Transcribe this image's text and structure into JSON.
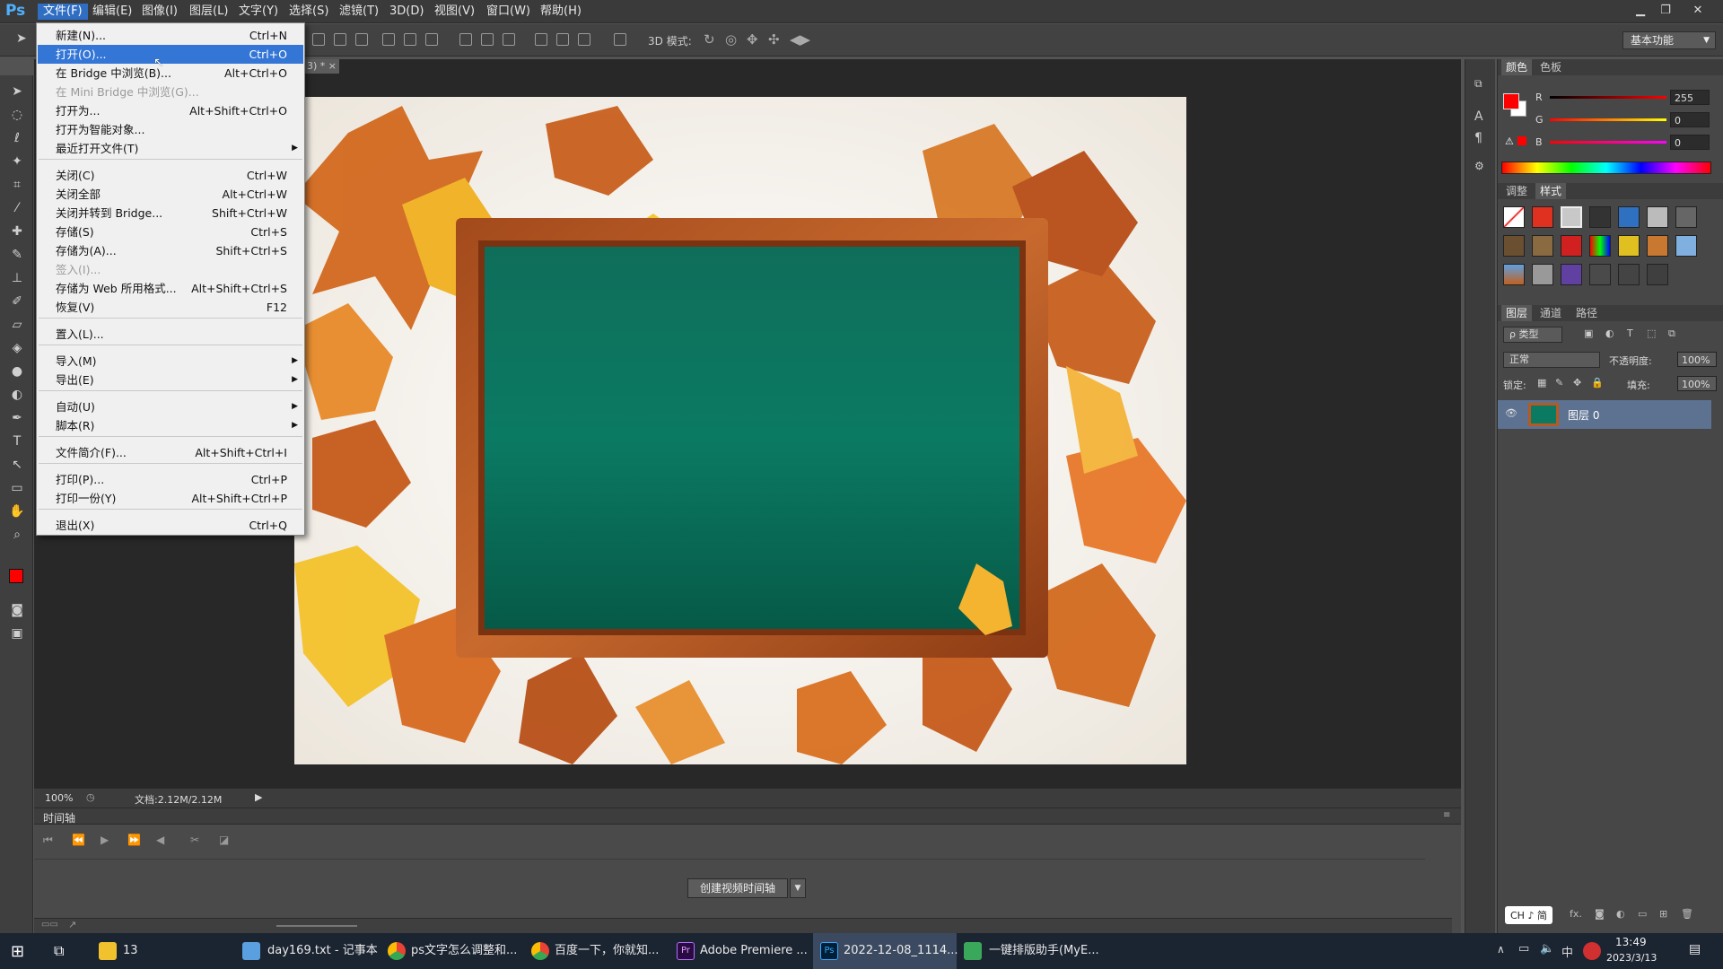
{
  "app": {
    "logo": "Ps",
    "menus": [
      "文件(F)",
      "编辑(E)",
      "图像(I)",
      "图层(L)",
      "文字(Y)",
      "选择(S)",
      "滤镜(T)",
      "3D(D)",
      "视图(V)",
      "窗口(W)",
      "帮助(H)"
    ],
    "active_menu_index": 0,
    "window_controls": [
      "minimize",
      "restore",
      "close"
    ]
  },
  "options_bar": {
    "mode_label": "3D 模式:",
    "workspace": "基本功能"
  },
  "document": {
    "tab_text": "3) * ×",
    "zoom": "100%",
    "doc_info": "文档:2.12M/2.12M"
  },
  "file_menu": {
    "items": [
      {
        "label": "新建(N)...",
        "shortcut": "Ctrl+N"
      },
      {
        "label": "打开(O)...",
        "shortcut": "Ctrl+O",
        "highlighted": true
      },
      {
        "label": "在 Bridge 中浏览(B)...",
        "shortcut": "Alt+Ctrl+O"
      },
      {
        "label": "在 Mini Bridge 中浏览(G)...",
        "shortcut": "",
        "disabled": true
      },
      {
        "label": "打开为...",
        "shortcut": "Alt+Shift+Ctrl+O"
      },
      {
        "label": "打开为智能对象...",
        "shortcut": ""
      },
      {
        "label": "最近打开文件(T)",
        "shortcut": "",
        "submenu": true
      },
      {
        "label": "关闭(C)",
        "shortcut": "Ctrl+W"
      },
      {
        "label": "关闭全部",
        "shortcut": "Alt+Ctrl+W"
      },
      {
        "label": "关闭并转到 Bridge...",
        "shortcut": "Shift+Ctrl+W"
      },
      {
        "label": "存储(S)",
        "shortcut": "Ctrl+S"
      },
      {
        "label": "存储为(A)...",
        "shortcut": "Shift+Ctrl+S"
      },
      {
        "label": "签入(I)...",
        "shortcut": "",
        "disabled": true
      },
      {
        "label": "存储为 Web 所用格式...",
        "shortcut": "Alt+Shift+Ctrl+S"
      },
      {
        "label": "恢复(V)",
        "shortcut": "F12"
      },
      {
        "label": "置入(L)...",
        "shortcut": ""
      },
      {
        "label": "导入(M)",
        "shortcut": "",
        "submenu": true
      },
      {
        "label": "导出(E)",
        "shortcut": "",
        "submenu": true
      },
      {
        "label": "自动(U)",
        "shortcut": "",
        "submenu": true
      },
      {
        "label": "脚本(R)",
        "shortcut": "",
        "submenu": true
      },
      {
        "label": "文件简介(F)...",
        "shortcut": "Alt+Shift+Ctrl+I"
      },
      {
        "label": "打印(P)...",
        "shortcut": "Ctrl+P"
      },
      {
        "label": "打印一份(Y)",
        "shortcut": "Alt+Shift+Ctrl+P"
      },
      {
        "label": "退出(X)",
        "shortcut": "Ctrl+Q"
      }
    ]
  },
  "color_panel": {
    "tabs": [
      "颜色",
      "色板"
    ],
    "channels": [
      {
        "name": "R",
        "value": "255",
        "color": "#ff0000"
      },
      {
        "name": "G",
        "value": "0",
        "color": "#00ff00"
      },
      {
        "name": "B",
        "value": "0",
        "color": "#0000ff"
      }
    ],
    "foreground": "#ff0000",
    "background": "#ffffff"
  },
  "styles_panel": {
    "tabs": [
      "调整",
      "样式"
    ]
  },
  "layers_panel": {
    "tabs": [
      "图层",
      "通道",
      "路径"
    ],
    "filter_label": "ρ 类型",
    "blend_mode": "正常",
    "opacity_label": "不透明度:",
    "opacity": "100%",
    "lock_label": "锁定:",
    "fill_label": "填充:",
    "fill": "100%",
    "layers": [
      {
        "name": "图层 0"
      }
    ],
    "ime_badge": "CH ♪ 简"
  },
  "timeline": {
    "title": "时间轴",
    "create_button": "创建视频时间轴"
  },
  "taskbar": {
    "items": [
      {
        "label": "13"
      },
      {
        "label": "day169.txt - 记事本"
      },
      {
        "label": "ps文字怎么调整和..."
      },
      {
        "label": "百度一下，你就知..."
      },
      {
        "label": "Adobe Premiere ..."
      },
      {
        "label": "2022-12-08_1114...",
        "active": true
      },
      {
        "label": "一键排版助手(MyE..."
      }
    ],
    "tray": {
      "ime": "中",
      "time": "13:49",
      "date": "2023/3/13"
    }
  }
}
